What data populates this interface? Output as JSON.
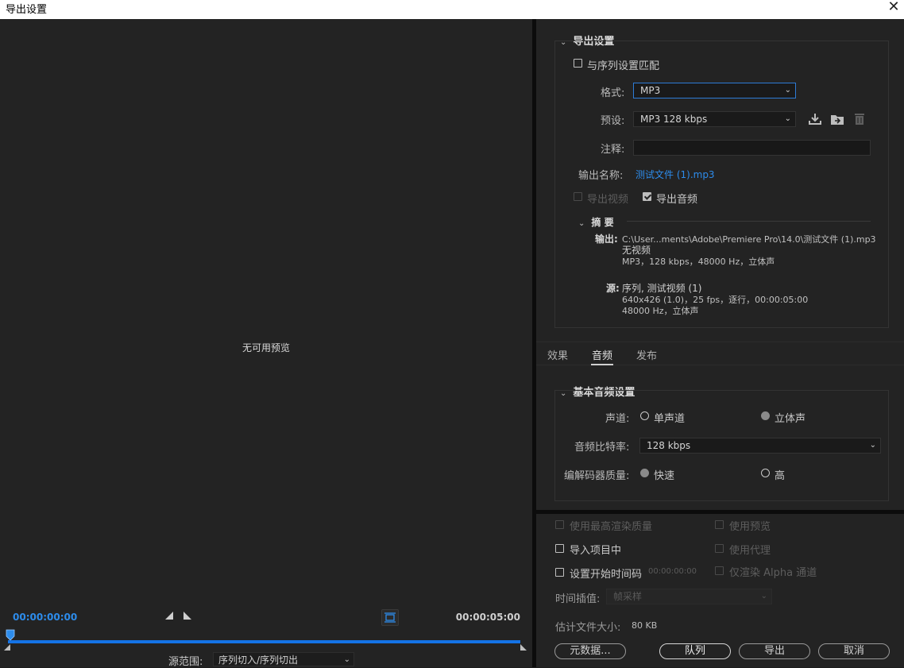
{
  "window": {
    "title": "导出设置",
    "close_glyph": "✕"
  },
  "preview": {
    "no_preview_text": "无可用预览",
    "timecode_start": "00:00:00:00",
    "timecode_end": "00:00:05:00",
    "source_range_label": "源范围:",
    "source_range_value": "序列切入/序列切出"
  },
  "export_settings": {
    "header": "导出设置",
    "match_sequence_label": "与序列设置匹配",
    "match_sequence_checked": false,
    "format_label": "格式:",
    "format_value": "MP3",
    "preset_label": "预设:",
    "preset_value": "MP3 128 kbps",
    "comments_label": "注释:",
    "comments_value": "",
    "output_name_label": "输出名称:",
    "output_name_value": "测试文件 (1).mp3",
    "export_video_label": "导出视频",
    "export_video_checked": false,
    "export_audio_label": "导出音频",
    "export_audio_checked": true,
    "icons": [
      "save-preset-icon",
      "import-preset-icon",
      "delete-preset-icon"
    ]
  },
  "summary": {
    "header": "摘 要",
    "output_key": "输出:",
    "output_path": "C:\\User...ments\\Adobe\\Premiere  Pro\\14.0\\测试文件 (1).mp3",
    "output_line2": "无视频",
    "output_line3": "MP3，128 kbps，48000 Hz，立体声",
    "source_key": "源:",
    "source_line1": "序列, 测试视频 (1)",
    "source_line2": "640x426 (1.0)，25 fps，逐行，00:00:05:00",
    "source_line3": "48000 Hz，立体声"
  },
  "tabs": [
    {
      "label": "效果",
      "active": false
    },
    {
      "label": "音频",
      "active": true
    },
    {
      "label": "发布",
      "active": false
    }
  ],
  "audio": {
    "header": "基本音频设置",
    "channels_label": "声道:",
    "mono_label": "单声道",
    "stereo_label": "立体声",
    "channels_selected": "立体声",
    "bitrate_label": "音频比特率:",
    "bitrate_value": "128 kbps",
    "quality_label": "编解码器质量:",
    "fast_label": "快速",
    "high_label": "高",
    "quality_selected": "快速"
  },
  "footer": {
    "max_render_quality": "使用最高渲染质量",
    "use_previews": "使用预览",
    "import_into_project": "导入项目中",
    "use_proxies": "使用代理",
    "set_start_timecode": "设置开始时间码",
    "start_timecode_value": "00:00:00:00",
    "render_alpha_only": "仅渲染 Alpha 通道",
    "time_interpolation_label": "时间插值:",
    "time_interpolation_value": "帧采样",
    "estimated_size_label": "估计文件大小:",
    "estimated_size_value": "80 KB",
    "buttons": {
      "metadata": "元数据...",
      "queue": "队列",
      "export": "导出",
      "cancel": "取消"
    }
  },
  "colors": {
    "accent": "#2d8ceb",
    "timeline": "#1473e6",
    "background": "#232323"
  }
}
